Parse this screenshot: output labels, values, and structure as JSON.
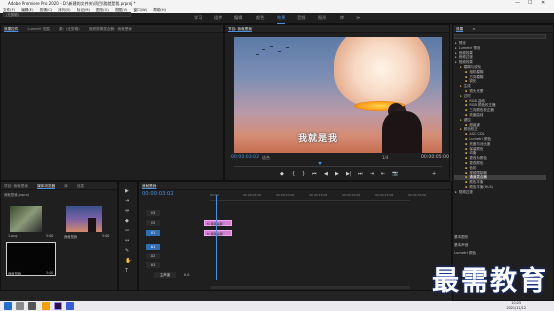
{
  "window": {
    "title": "Adobe Premiere Pro 2020 - D:\\新建的文件夹\\项目\\我就是我.prproj *",
    "controls": [
      "—",
      "☐",
      "✕"
    ]
  },
  "menu": [
    "文件(F)",
    "编辑(E)",
    "剪辑(C)",
    "序列(S)",
    "标记(M)",
    "图形(G)",
    "视图(V)",
    "窗口(W)",
    "帮助(H)"
  ],
  "workspaces": [
    "学习",
    "组件",
    "编辑",
    "颜色",
    "效果",
    "音频",
    "图形",
    "库",
    "≫"
  ],
  "active_workspace": "效果",
  "source_panel": {
    "tabs": [
      "效果控件",
      "Lumetri 范围",
      "源：(无剪辑)",
      "音频剪辑混合器：我就是我"
    ],
    "dropdown": "(无剪辑)"
  },
  "program_panel": {
    "title": "节目: 我就是我",
    "subtitle": "我就是我",
    "timecode_left": "00:00:03:02",
    "fit": "适合",
    "resolution": "1/4",
    "timecode_right": "00:00:05:00",
    "transport": [
      "◆",
      "{",
      "}",
      "⏮",
      "◀",
      "▶",
      "▶|",
      "⏭",
      "⇥",
      "⇤",
      "📷",
      "+"
    ]
  },
  "project_panel": {
    "tabs": [
      "项目: 我就是我",
      "媒体浏览器",
      "库",
      "信息",
      "效果控件"
    ],
    "bin": "我就是我.prproj",
    "items": [
      {
        "name": "1.png",
        "meta": "5:00"
      },
      {
        "name": "我就是我",
        "meta": "5:00"
      },
      {
        "name": "我就是我",
        "meta": "5:00"
      }
    ]
  },
  "tools": [
    "▶",
    "⇥",
    "⇹",
    "◆",
    "✂",
    "↔",
    "✎",
    "✋",
    "T"
  ],
  "timeline": {
    "tab": "我就是我",
    "timecode": "00:00:03:02",
    "ruler": [
      "00:00",
      "00:00:05:00",
      "00:00:10:00",
      "00:00:15:00",
      "00:00:20:00",
      "00:00:25:00",
      "00:00:30:00"
    ],
    "tracks": [
      "V3",
      "V2",
      "V1",
      "A1",
      "A2",
      "A3",
      "主声道"
    ],
    "master_value": "0.0",
    "clips": [
      {
        "track": "V2",
        "label": "fx 我就是我"
      },
      {
        "track": "V1",
        "label": "fx 我就是我"
      }
    ]
  },
  "effects_panel": {
    "tabs": [
      "效果",
      "≡"
    ],
    "search": "",
    "tree": [
      {
        "indent": 0,
        "folder": true,
        "label": "预设"
      },
      {
        "indent": 0,
        "folder": true,
        "label": "Lumetri 预设"
      },
      {
        "indent": 0,
        "folder": true,
        "label": "音频效果"
      },
      {
        "indent": 0,
        "folder": true,
        "label": "音频过渡"
      },
      {
        "indent": 0,
        "folder": true,
        "label": "视频效果"
      },
      {
        "indent": 1,
        "folder": true,
        "label": "模糊与锐化"
      },
      {
        "indent": 2,
        "folder": false,
        "label": "相机模糊"
      },
      {
        "indent": 2,
        "folder": false,
        "label": "方向模糊"
      },
      {
        "indent": 2,
        "folder": false,
        "label": "锐化"
      },
      {
        "indent": 1,
        "folder": true,
        "label": "生成"
      },
      {
        "indent": 2,
        "folder": false,
        "label": "镜头光晕"
      },
      {
        "indent": 1,
        "folder": true,
        "label": "过时"
      },
      {
        "indent": 2,
        "folder": false,
        "label": "RGB 曲线"
      },
      {
        "indent": 2,
        "folder": false,
        "label": "RGB 颜色校正器"
      },
      {
        "indent": 2,
        "folder": false,
        "label": "三向颜色校正器"
      },
      {
        "indent": 2,
        "folder": false,
        "label": "亮度曲线"
      },
      {
        "indent": 1,
        "folder": true,
        "label": "键控"
      },
      {
        "indent": 2,
        "folder": false,
        "label": "超级键"
      },
      {
        "indent": 1,
        "folder": true,
        "label": "颜色校正"
      },
      {
        "indent": 2,
        "folder": false,
        "label": "ASC CDL"
      },
      {
        "indent": 2,
        "folder": false,
        "label": "Lumetri 颜色"
      },
      {
        "indent": 2,
        "folder": false,
        "label": "亮度与对比度"
      },
      {
        "indent": 2,
        "folder": false,
        "label": "保留颜色"
      },
      {
        "indent": 2,
        "folder": false,
        "label": "均衡"
      },
      {
        "indent": 2,
        "folder": false,
        "label": "更改为颜色"
      },
      {
        "indent": 2,
        "folder": false,
        "label": "更改颜色"
      },
      {
        "indent": 2,
        "folder": false,
        "label": "色彩"
      },
      {
        "indent": 2,
        "folder": false,
        "label": "视频限制器"
      },
      {
        "indent": 2,
        "folder": false,
        "label": "通道混合器",
        "selected": true
      },
      {
        "indent": 2,
        "folder": false,
        "label": "颜色平衡"
      },
      {
        "indent": 2,
        "folder": false,
        "label": "颜色平衡(HLS)"
      },
      {
        "indent": 0,
        "folder": true,
        "label": "视频过渡"
      }
    ],
    "bottom": [
      "基本图形",
      "基本声音",
      "Lumetri 颜色"
    ]
  },
  "taskbar": {
    "time": "10:25",
    "date": "2021/11/12"
  },
  "watermark": "最需教育",
  "colors": {
    "accent": "#4a90e2",
    "clip": "#d27fd0"
  }
}
